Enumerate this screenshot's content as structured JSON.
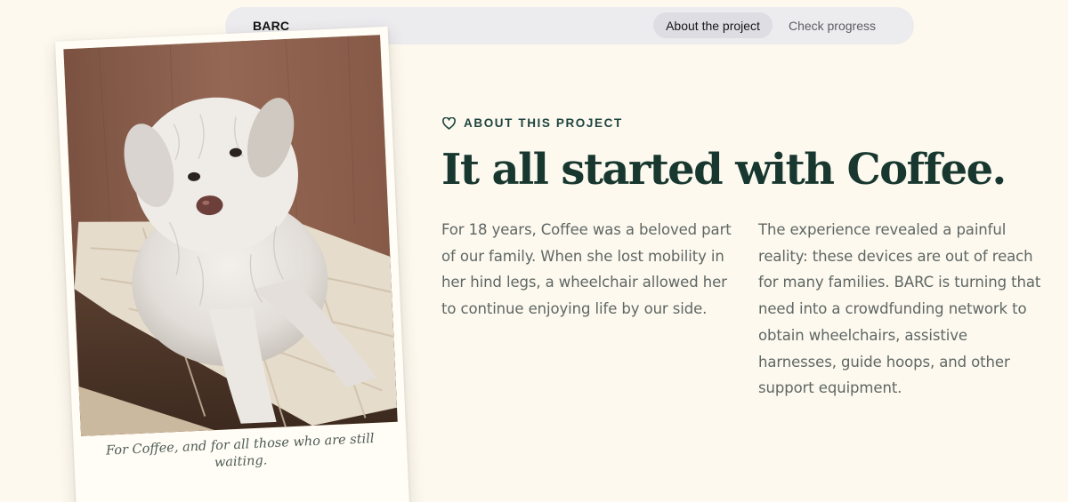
{
  "nav": {
    "brand": "BARC",
    "links": [
      {
        "label": "About the project",
        "active": true
      },
      {
        "label": "Check progress",
        "active": false
      }
    ]
  },
  "polaroid": {
    "photo_subject": "white shaggy dog lying on a quilted bed",
    "caption": "For Coffee, and for all those who are still waiting."
  },
  "about": {
    "eyebrow_icon": "heart-icon",
    "eyebrow": "ABOUT THIS PROJECT",
    "headline": "It all started with Coffee.",
    "paragraph_left": "For 18 years, Coffee was a beloved part of our family. When she lost mobility in her hind legs, a wheelchair allowed her to continue enjoying life by our side.",
    "paragraph_right": "The experience revealed a painful reality: these devices are out of reach for many families. BARC is turning that need into a crowdfunding network to obtain wheelchairs, assistive harnesses, guide hoops, and other support equipment."
  },
  "colors": {
    "background": "#fdf9ef",
    "nav_background": "#ecebee",
    "nav_active": "#dddde3",
    "heading": "#17372f",
    "eyebrow": "#1f4540",
    "body_text": "#5f6763"
  }
}
